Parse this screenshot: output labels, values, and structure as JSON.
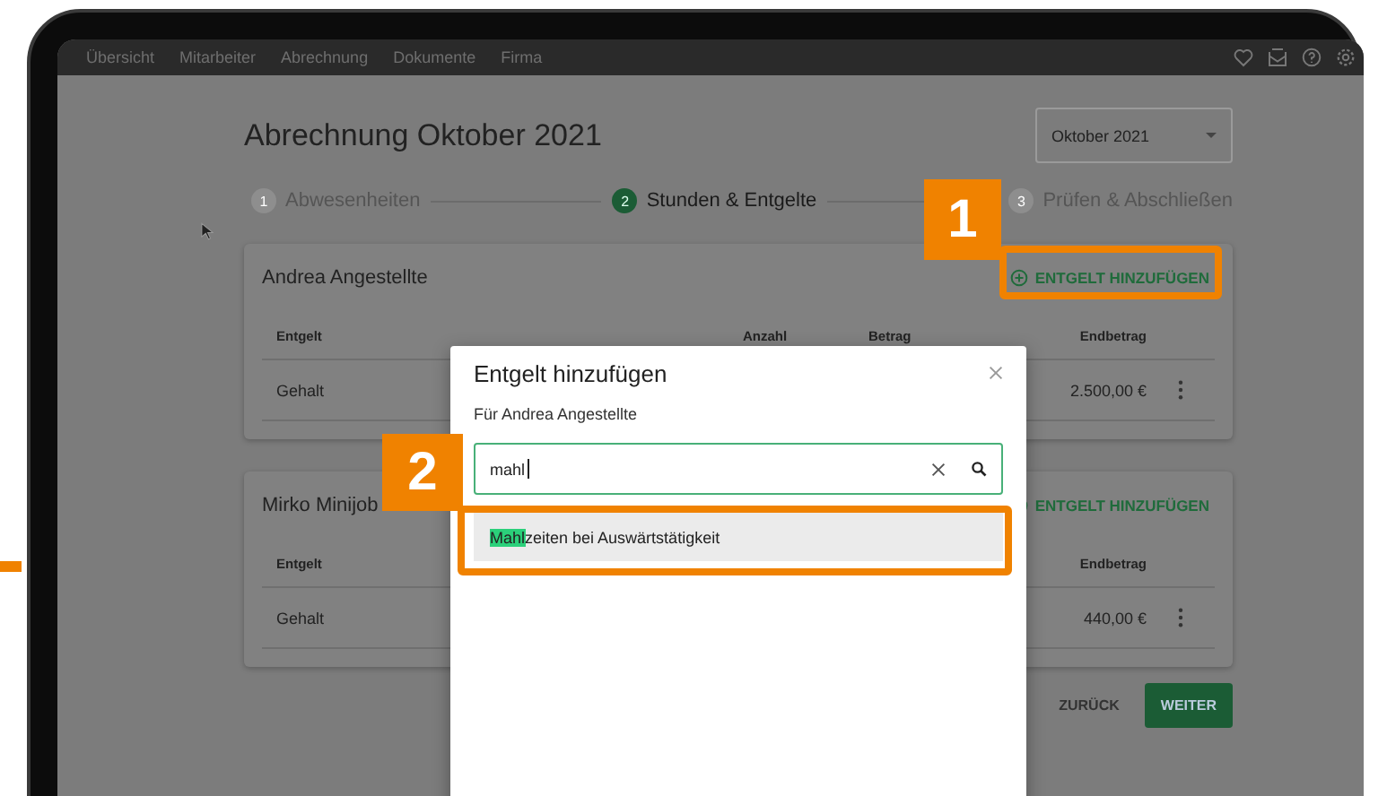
{
  "nav": {
    "items": [
      "Übersicht",
      "Mitarbeiter",
      "Abrechnung",
      "Dokumente",
      "Firma"
    ]
  },
  "page": {
    "title": "Abrechnung Oktober 2021",
    "month_select": "Oktober 2021"
  },
  "steps": [
    {
      "number": "1",
      "label": "Abwesenheiten",
      "selected": false
    },
    {
      "number": "2",
      "label": "Stunden & Entgelte",
      "selected": true
    },
    {
      "number": "3",
      "label": "Prüfen & Abschließen",
      "selected": false
    }
  ],
  "cards": [
    {
      "name": "Andrea Angestellte",
      "add_button": "ENTGELT HINZUFÜGEN",
      "columns": [
        {
          "label": "Entgelt",
          "kind": "name"
        },
        {
          "label": "Anzahl",
          "kind": "count"
        },
        {
          "label": "Betrag",
          "kind": "amount"
        },
        {
          "label": "Endbetrag",
          "kind": "total"
        }
      ],
      "rows": [
        {
          "entgelt": "Gehalt",
          "endbetrag": "2.500,00 €"
        }
      ]
    },
    {
      "name": "Mirko Minijob",
      "add_button": "ENTGELT HINZUFÜGEN",
      "columns": [
        {
          "label": "Entgelt",
          "kind": "name"
        },
        {
          "label": "Endbetrag",
          "kind": "total"
        }
      ],
      "rows": [
        {
          "entgelt": "Gehalt",
          "endbetrag": "440,00 €"
        }
      ]
    }
  ],
  "footer": {
    "back": "ZURÜCK",
    "next": "WEITER"
  },
  "modal": {
    "title": "Entgelt hinzufügen",
    "subtitle": "Für Andrea Angestellte",
    "search_value": "mahl",
    "suggestions": [
      {
        "text": "**Mahl**zeiten bei Auswärtstätigkeit",
        "selected": true
      }
    ]
  },
  "callouts": [
    {
      "number": "1"
    },
    {
      "number": "2"
    }
  ]
}
